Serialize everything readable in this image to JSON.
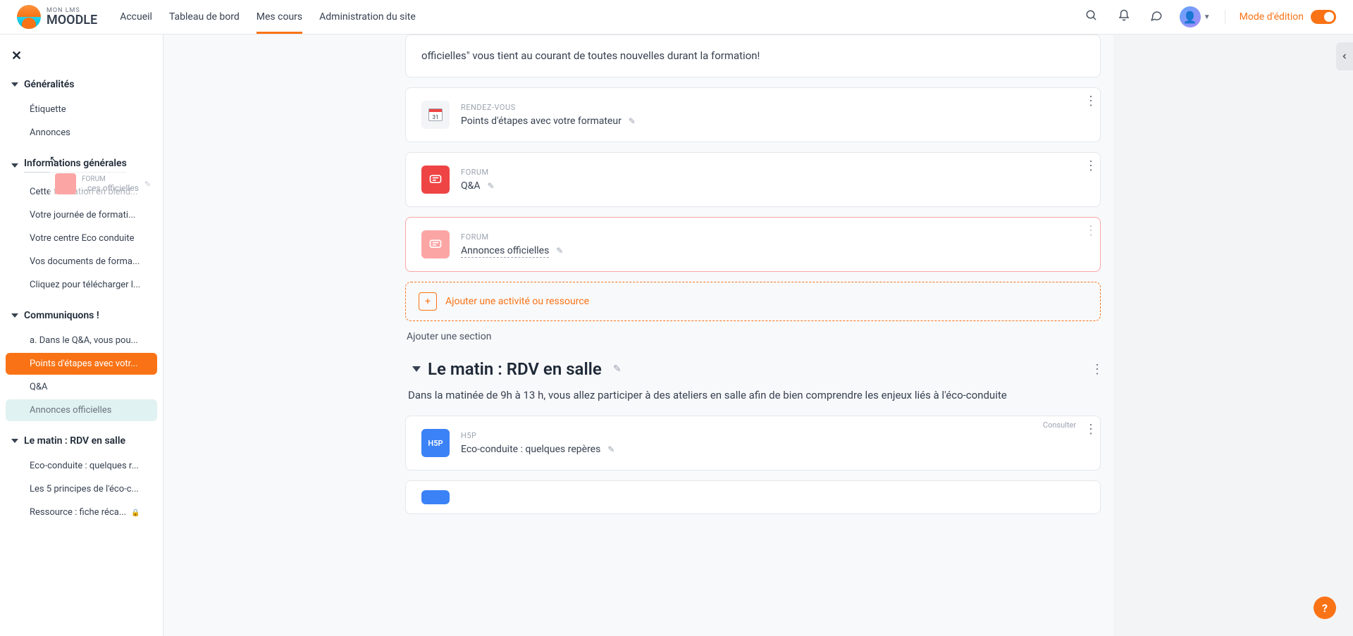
{
  "brand": {
    "top": "MON LMS",
    "bottom": "MOODLE"
  },
  "nav": {
    "items": [
      "Accueil",
      "Tableau de bord",
      "Mes cours",
      "Administration du site"
    ],
    "activeIndex": 2
  },
  "editMode": {
    "label": "Mode d'édition"
  },
  "close": "✕",
  "sidebar": {
    "sections": [
      {
        "title": "Généralités",
        "items": [
          {
            "label": "Étiquette"
          },
          {
            "label": "Annonces"
          }
        ]
      },
      {
        "title": "Informations générales",
        "underline": true,
        "items": [
          {
            "label": "Cette formation en blend..."
          },
          {
            "label": "Votre journée de formati..."
          },
          {
            "label": "Votre centre Eco conduite"
          },
          {
            "label": "Vos documents de forma..."
          },
          {
            "label": "Cliquez pour télécharger l..."
          }
        ]
      },
      {
        "title": "Communiquons !",
        "items": [
          {
            "label": "a. Dans le Q&A, vous pou..."
          },
          {
            "label": "Points d'étapes avec votr...",
            "highlighted": true
          },
          {
            "label": "Q&A"
          },
          {
            "label": "Annonces officielles",
            "muted": true
          }
        ]
      },
      {
        "title": "Le matin : RDV en salle",
        "items": [
          {
            "label": "Eco-conduite : quelques r..."
          },
          {
            "label": "Les 5 principes de l'éco-c..."
          },
          {
            "label": "Ressource : fiche réca...",
            "locked": true
          }
        ]
      }
    ]
  },
  "ghost": {
    "type": "FORUM",
    "name": "…ces officielles"
  },
  "content": {
    "introTail": "officielles\" vous tient au courant de toutes nouvelles durant la formation!",
    "activities": [
      {
        "type": "RENDEZ-VOUS",
        "name": "Points d'étapes avec votre formateur",
        "icon": "calendar"
      },
      {
        "type": "FORUM",
        "name": "Q&A",
        "icon": "forum-red"
      },
      {
        "type": "FORUM",
        "name": "Annonces officielles",
        "icon": "forum-light",
        "highlight": true,
        "underline": true
      }
    ],
    "addActivity": "Ajouter une activité ou ressource",
    "addSection": "Ajouter une section",
    "nextSection": {
      "title": "Le matin : RDV en salle",
      "desc": "Dans la matinée de 9h à 13 h, vous allez participer à des ateliers en salle afin de bien comprendre les enjeux liés à l'éco-conduite",
      "activities": [
        {
          "type": "H5P",
          "name": "Eco-conduite : quelques repères",
          "icon": "h5p",
          "badge": "Consulter"
        }
      ]
    }
  },
  "help": "?"
}
